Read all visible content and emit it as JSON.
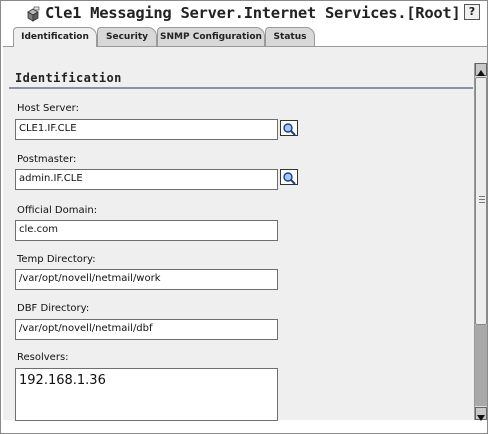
{
  "window": {
    "title": "Cle1 Messaging Server.Internet Services.[Root]",
    "help_label": "?"
  },
  "tabs": [
    {
      "label": "Identification",
      "active": true
    },
    {
      "label": "Security",
      "active": false
    },
    {
      "label": "SNMP Configuration",
      "active": false
    },
    {
      "label": "Status",
      "active": false
    }
  ],
  "section": {
    "title": "Identification"
  },
  "fields": {
    "host_server": {
      "label": "Host Server:",
      "value": "CLE1.IF.CLE"
    },
    "postmaster": {
      "label": "Postmaster:",
      "value": "admin.IF.CLE"
    },
    "official_domain": {
      "label": "Official Domain:",
      "value": "cle.com"
    },
    "temp_directory": {
      "label": "Temp Directory:",
      "value": "/var/opt/novell/netmail/work"
    },
    "dbf_directory": {
      "label": "DBF Directory:",
      "value": "/var/opt/novell/netmail/dbf"
    },
    "resolvers": {
      "label": "Resolvers:",
      "value": "192.168.1.36"
    }
  },
  "icons": {
    "title": "server-object-icon",
    "browse": "magnifier-browse-icon",
    "scroll_up": "arrow-up-icon",
    "scroll_down": "arrow-down-icon"
  }
}
